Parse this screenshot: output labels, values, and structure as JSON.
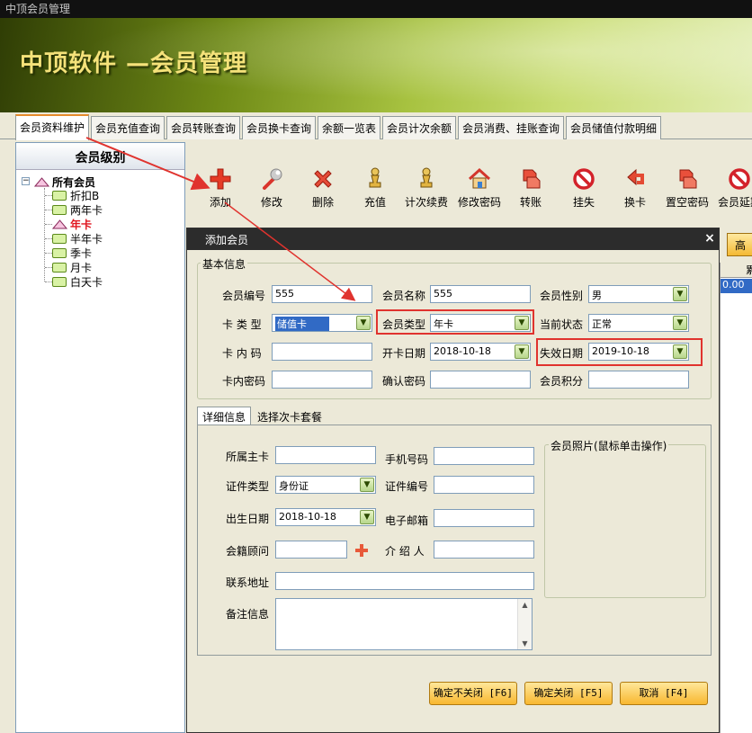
{
  "window": {
    "title": "中顶会员管理"
  },
  "banner": {
    "title": "中顶软件 —会员管理"
  },
  "tabs": [
    {
      "label": "会员资料维护"
    },
    {
      "label": "会员充值查询"
    },
    {
      "label": "会员转账查询"
    },
    {
      "label": "会员换卡查询"
    },
    {
      "label": "余额一览表"
    },
    {
      "label": "会员计次余额"
    },
    {
      "label": "会员消费、挂账查询"
    },
    {
      "label": "会员储值付款明细"
    }
  ],
  "left_panel": {
    "header": "会员级别",
    "root": "所有会员",
    "items": [
      {
        "label": "折扣B"
      },
      {
        "label": "两年卡"
      },
      {
        "label": "年卡"
      },
      {
        "label": "半年卡"
      },
      {
        "label": "季卡"
      },
      {
        "label": "月卡"
      },
      {
        "label": "白天卡"
      }
    ]
  },
  "toolbar": [
    {
      "label": "添加",
      "icon": "plus-icon"
    },
    {
      "label": "修改",
      "icon": "wrench-icon"
    },
    {
      "label": "删除",
      "icon": "delete-x-icon"
    },
    {
      "label": "充值",
      "icon": "pawn-icon"
    },
    {
      "label": "计次续费",
      "icon": "pawn-icon"
    },
    {
      "label": "修改密码",
      "icon": "house-icon"
    },
    {
      "label": "转账",
      "icon": "transfer-icon"
    },
    {
      "label": "挂失",
      "icon": "no-entry-icon"
    },
    {
      "label": "换卡",
      "icon": "swap-icon"
    },
    {
      "label": "置空密码",
      "icon": "transfer-icon"
    },
    {
      "label": "会员延期",
      "icon": "no-entry-icon"
    }
  ],
  "right_area": {
    "button_label": "高级",
    "grid_header": "累",
    "grid_value": "0.00"
  },
  "dialog": {
    "title": "添加会员",
    "close": "×",
    "basic": {
      "legend": "基本信息",
      "member_no_label": "会员编号",
      "member_no": "555",
      "member_name_label": "会员名称",
      "member_name": "555",
      "gender_label": "会员性别",
      "gender": "男",
      "card_type_label": "卡 类 型",
      "card_type": "储值卡",
      "member_type_label": "会员类型",
      "member_type": "年卡",
      "status_label": "当前状态",
      "status": "正常",
      "card_code_label": "卡 内 码",
      "card_code": "",
      "open_date_label": "开卡日期",
      "open_date": "2018-10-18",
      "expire_date_label": "失效日期",
      "expire_date": "2019-10-18",
      "card_pwd_label": "卡内密码",
      "card_pwd": "",
      "confirm_pwd_label": "确认密码",
      "confirm_pwd": "",
      "points_label": "会员积分",
      "points": ""
    },
    "subtabs": [
      {
        "label": "详细信息"
      },
      {
        "label": "选择次卡套餐"
      }
    ],
    "detail": {
      "main_card_label": "所属主卡",
      "main_card": "",
      "phone_label": "手机号码",
      "phone": "",
      "id_type_label": "证件类型",
      "id_type": "身份证",
      "id_no_label": "证件编号",
      "id_no": "",
      "birth_label": "出生日期",
      "birth": "2018-10-18",
      "email_label": "电子邮箱",
      "email": "",
      "advisor_label": "会籍顾问",
      "advisor": "",
      "referrer_label": "介 绍 人",
      "referrer": "",
      "address_label": "联系地址",
      "address": "",
      "remark_label": "备注信息",
      "remark": "",
      "photo_legend": "会员照片(鼠标单击操作)"
    },
    "buttons": {
      "confirm_keep": "确定不关闭 [F6]",
      "confirm_close": "确定关闭 [F5]",
      "cancel": "取消 [F4]"
    }
  },
  "colors": {
    "accent_orange": "#f8b72f",
    "highlight_red": "#e0332e",
    "selection_blue": "#316ac5",
    "banner_green": "#6f8a16"
  }
}
